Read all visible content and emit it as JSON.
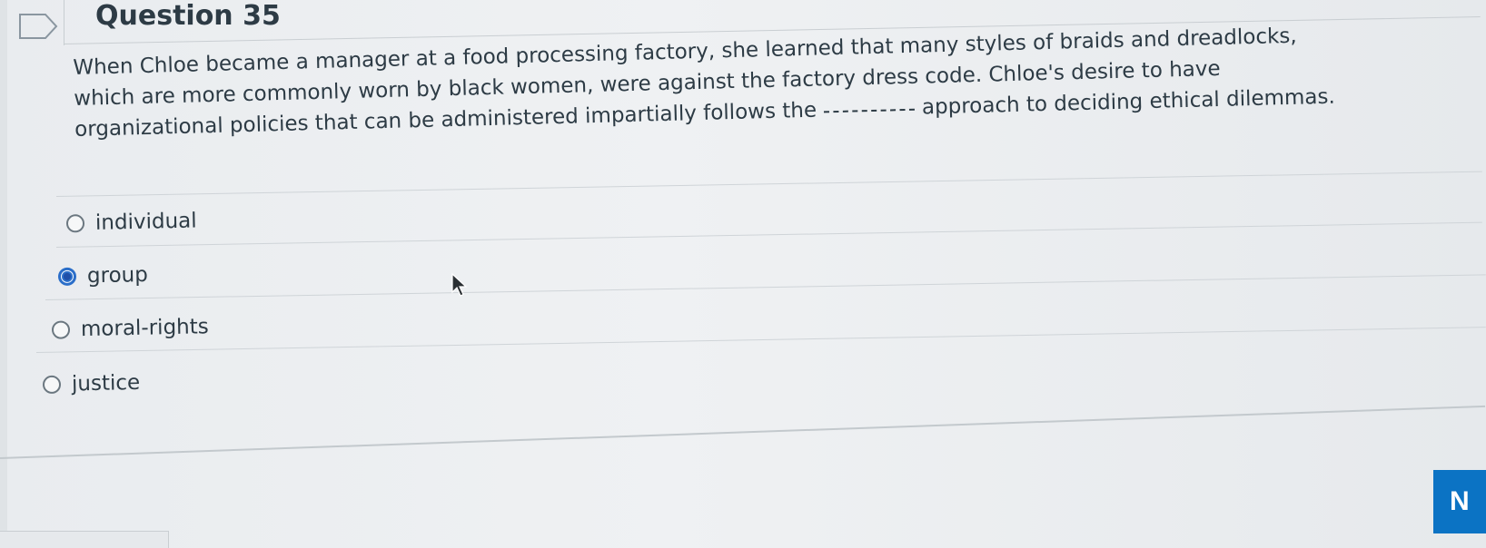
{
  "question": {
    "title": "Question 35",
    "text_lines": [
      "When Chloe became a manager at a food processing factory, she learned that many styles of braids and dreadlocks,",
      "which are more commonly worn by black women, were against the factory dress code. Chloe's desire to have",
      "organizational policies that can be administered impartially follows the"
    ],
    "text_after_blank": "approach to deciding ethical dilemmas."
  },
  "answers": [
    {
      "label": "individual",
      "selected": false
    },
    {
      "label": "group",
      "selected": true
    },
    {
      "label": "moral-rights",
      "selected": false
    },
    {
      "label": "justice",
      "selected": false
    }
  ],
  "next_button": {
    "label": "N"
  },
  "colors": {
    "accent": "#0b73c4",
    "text": "#2d3b45",
    "selected_radio": "#2b6ec9"
  },
  "icons": {
    "flag": "flag-icon",
    "cursor": "mouse-pointer-icon"
  }
}
